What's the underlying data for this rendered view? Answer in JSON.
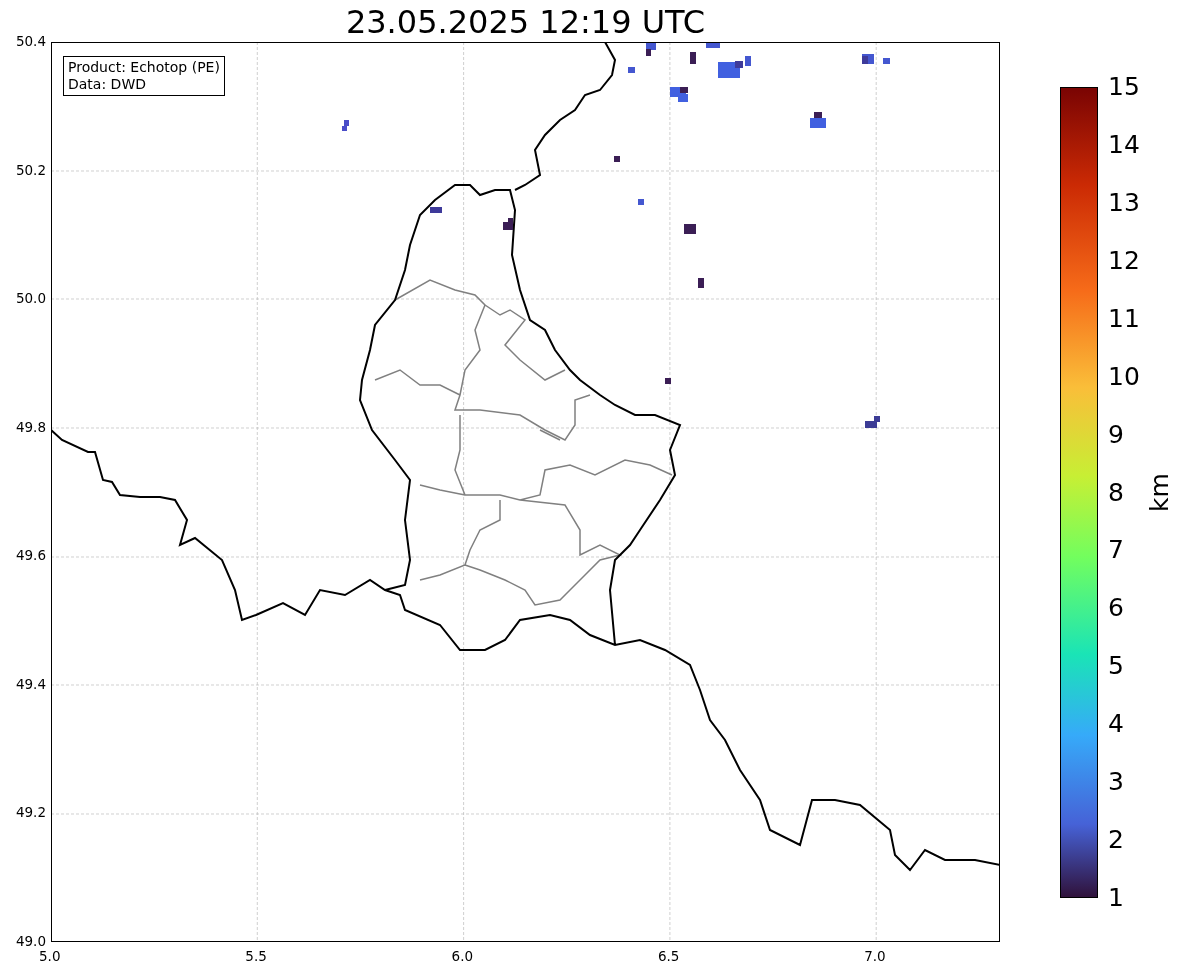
{
  "title": "23.05.2025 12:19 UTC",
  "info_box": [
    "Product: Echotop (PE)",
    "Data: DWD"
  ],
  "y_ticks": [
    "50.4",
    "50.2",
    "50.0",
    "49.8",
    "49.6",
    "49.4",
    "49.2",
    "49.0"
  ],
  "x_ticks": [
    "5.0",
    "5.5",
    "6.0",
    "6.5",
    "7.0"
  ],
  "colorbar": {
    "label": "km",
    "ticks": [
      "15",
      "14",
      "13",
      "12",
      "11",
      "10",
      "9",
      "8",
      "7",
      "6",
      "5",
      "4",
      "3",
      "2",
      "1"
    ]
  }
}
